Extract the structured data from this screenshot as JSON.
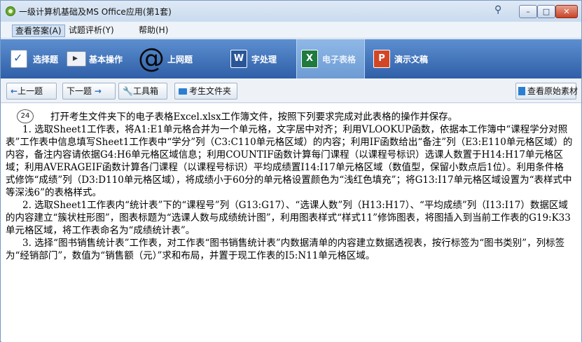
{
  "window": {
    "title": "一级计算机基础及MS Office应用(第1套)",
    "pin_icon": "pin-icon",
    "controls": {
      "minimize": "–",
      "maximize": "□",
      "close": "✕"
    }
  },
  "menu": {
    "items": [
      {
        "label": "查看答案(A)"
      },
      {
        "label": "试题评析(Y)"
      },
      {
        "label": "帮助(H)"
      }
    ]
  },
  "categories": [
    {
      "label": "选择题",
      "icon": "checkmark-icon"
    },
    {
      "label": "基本操作",
      "icon": "window-icon"
    },
    {
      "label": "上网题",
      "icon": "at-sign-icon",
      "glyph": "@"
    },
    {
      "label": "字处理",
      "icon": "word-icon",
      "glyph": "W"
    },
    {
      "label": "电子表格",
      "icon": "excel-icon",
      "glyph": "X",
      "selected": true
    },
    {
      "label": "演示文稿",
      "icon": "powerpoint-icon",
      "glyph": "P"
    }
  ],
  "toolbar": {
    "prev": {
      "arrow": "←",
      "label": "上一题"
    },
    "next": {
      "label": "下一题",
      "arrow": "→"
    },
    "tools": {
      "glyph": "🔧",
      "label": "工具箱"
    },
    "folder": {
      "label": "考生文件夹"
    },
    "original": {
      "label": "查看原始素材"
    }
  },
  "question": {
    "number": "24",
    "intro": "打开考生文件夹下的电子表格Excel.xlsx工作簿文件，按照下列要求完成对此表格的操作并保存。",
    "p1": "1. 选取Sheet1工作表，将A1:E1单元格合并为一个单元格，文字居中对齐；利用VLOOKUP函数，依据本工作簿中“课程学分对照表”工作表中信息填写Sheet1工作表中“学分”列（C3:C110单元格区域）的内容；利用IF函数给出“备注”列（E3:E110单元格区域）的内容，备注内容请依据G4:H6单元格区域信息；利用COUNTIF函数计算每门课程（以课程号标识）选课人数置于H14:H17单元格区域；利用AVERAGEIF函数计算各门课程（以课程号标识）平均成绩置I14:I17单元格区域（数值型，保留小数点后1位）。利用条件格式修饰“成绩”列（D3:D110单元格区域），将成绩小于60分的单元格设置颜色为“浅红色填充”；将G13:I17单元格区域设置为“表样式中等深浅6”的表格样式。",
    "p2": "2. 选取Sheet1工作表内“统计表”下的“课程号”列（G13:G17）、“选课人数”列（H13:H17）、“平均成绩”列（I13:I17）数据区域的内容建立“簇状柱形图”，图表标题为“选课人数与成绩统计图”，利用图表样式“样式11”修饰图表，将图插入到当前工作表的G19:K33单元格区域，将工作表命名为“成绩统计表”。",
    "p3": "3. 选择“图书销售统计表”工作表，对工作表“图书销售统计表”内数据清单的内容建立数据透视表，按行标签为“图书类别”，列标签为“经销部门”，数值为“销售额（元）”求和布局，并置于现工作表的I5:N11单元格区域。"
  },
  "colors": {
    "category_bar": "#2f5fa8",
    "selected_tab": "#8fb8e6",
    "close_button": "#c74328"
  }
}
